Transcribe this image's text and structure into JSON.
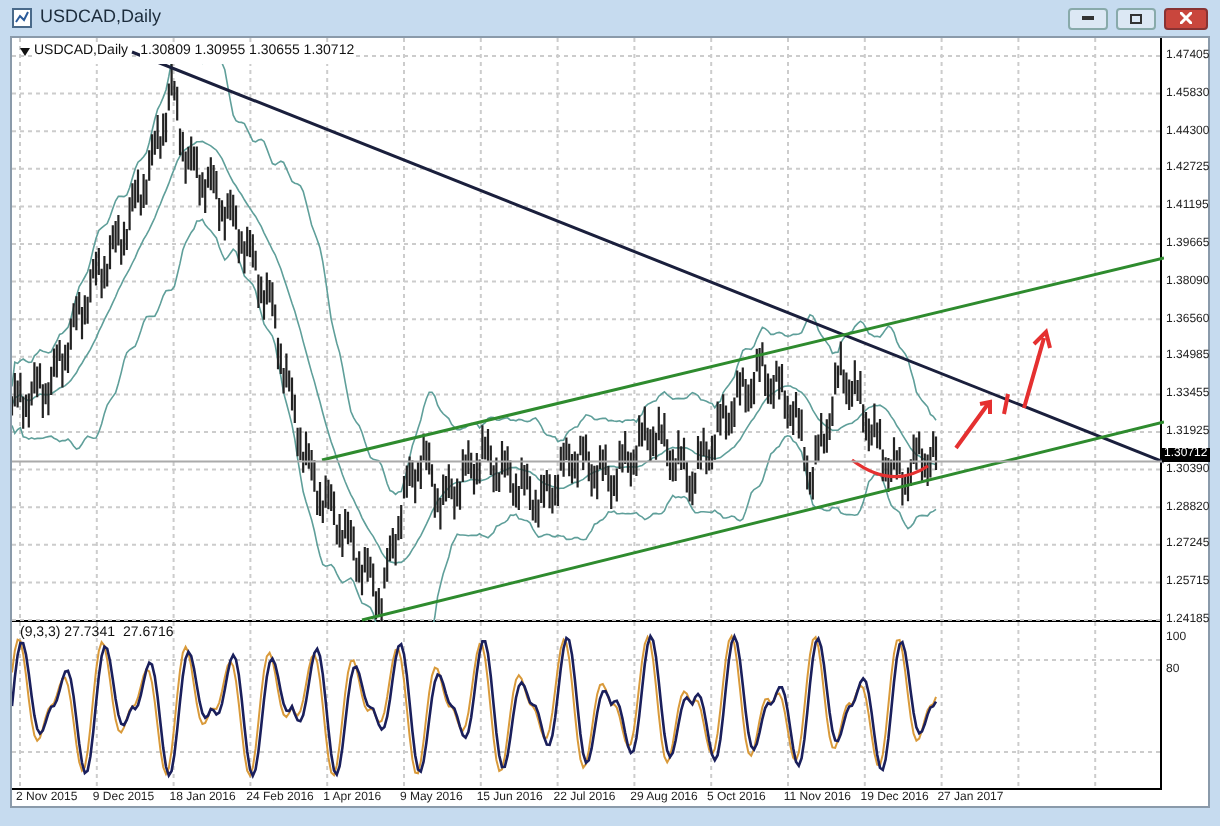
{
  "window": {
    "title": "USDCAD,Daily"
  },
  "chart": {
    "label": "USDCAD,Daily",
    "ohlc": "1.30809 1.30955 1.30655 1.30712",
    "current_price": "1.30712",
    "price_ticks": [
      "1.47405",
      "1.45830",
      "1.44300",
      "1.42725",
      "1.41195",
      "1.39665",
      "1.38090",
      "1.36560",
      "1.34985",
      "1.33455",
      "1.31925",
      "1.30390",
      "1.28820",
      "1.27245",
      "1.25715",
      "1.24185"
    ]
  },
  "oscillator": {
    "label": "(9,3,3) 27.7341",
    "value": "27.6716",
    "ticks": [
      "100",
      "80"
    ]
  },
  "dates": [
    "2 Nov 2015",
    "9 Dec 2015",
    "18 Jan 2016",
    "24 Feb 2016",
    "1 Apr 2016",
    "9 May 2016",
    "15 Jun 2016",
    "22 Jul 2016",
    "29 Aug 2016",
    "5 Oct 2016",
    "11 Nov 2016",
    "19 Dec 2016",
    "27 Jan 2017"
  ]
}
